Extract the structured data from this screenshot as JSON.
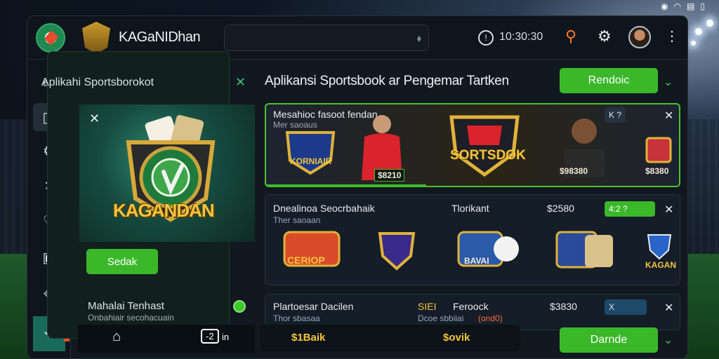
{
  "app": {
    "brand": "KAGaNIDhan"
  },
  "topbar": {
    "clock": "10:30:30"
  },
  "promo": {
    "title": "Aplikahi Sportsborokot",
    "emblem_text": "KAGANDAN",
    "button": "Sedak",
    "footer_title": "Mahalai Tenhast",
    "footer_sub": "Onbahiair secohacuain",
    "tv_label": "in"
  },
  "main": {
    "title": "Aplikansi Sportsbook ar Pengemar Tartken",
    "top_button": "Rendoic"
  },
  "featured": {
    "title": "Mesahioc fasoot fendan",
    "subtitle": "Mer saoaus",
    "badge_left": "KORNIAIR",
    "badge_center": "SORTSDOK",
    "pill": "K ?",
    "score_1": "$8210",
    "score_2": "$98380",
    "score_3": "$8380"
  },
  "card2": {
    "title": "Dnealinoa Seocrbahaik",
    "subtitle": "Ther saoaan",
    "middle": "Tlorikant",
    "amount": "$2580",
    "pill": "4:2 ?",
    "badge_1": "CERIOP",
    "badge_3": "BAVAI",
    "badge_5": "KAGAN"
  },
  "card3": {
    "title": "Plartoesar Dacilen",
    "subtitle": "Thor sbasaa",
    "middle1": "SIEI",
    "middle2": "Feroock",
    "middle_sub": "Dcoe sbbiiai",
    "middle_tag": "(ond0)",
    "amount": "$3830",
    "pill": "X"
  },
  "bottom": {
    "left": "$1Baik",
    "right": "$ovik",
    "button": "Darnde"
  },
  "colors": {
    "accent": "#3ab82a",
    "gold": "#f2c53b",
    "panel": "#111820"
  }
}
